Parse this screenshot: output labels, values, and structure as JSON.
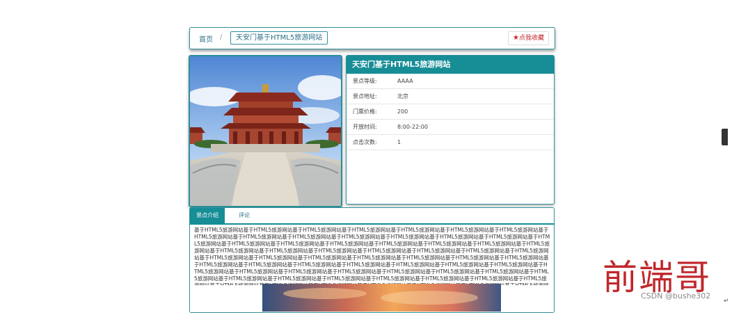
{
  "breadcrumb": {
    "home": "首页",
    "separator": "/",
    "current": "天安门基于HTML5旅游网站"
  },
  "favorite": {
    "icon": "star-icon",
    "label": "点我收藏"
  },
  "info": {
    "title": "天安门基于HTML5旅游网站",
    "rows": [
      {
        "key": "景点等级:",
        "value": "AAAA"
      },
      {
        "key": "景点地址:",
        "value": "北京"
      },
      {
        "key": "门票价格:",
        "value": "200"
      },
      {
        "key": "开放时间:",
        "value": "8:00-22:00"
      },
      {
        "key": "点击次数:",
        "value": "1"
      }
    ]
  },
  "tabs": [
    {
      "label": "景点介绍",
      "active": true
    },
    {
      "label": "评论",
      "active": false
    }
  ],
  "description": "基于HTML5旅游网站基于HTML5旅游网站基于HTML5旅游网站基于HTML5旅游网站基于HTML5旅游网站基于HTML5旅游网站基于HTML5旅游网站基于HTML5旅游网站基于HTML5旅游网站基于HTML5旅游网站基于HTML5旅游网站基于HTML5旅游网站基于HTML5旅游网站基于HTML5旅游网站基于HTML5旅游网站基于HTML5旅游网站基于HTML5旅游网站基于HTML5旅游网站基于HTML5旅游网站基于HTML5旅游网站基于HTML5旅游网站基于HTML5旅游网站基于HTML5旅游网站基于HTML5旅游网站基于HTML5旅游网站基于HTML5旅游网站基于HTML5旅游网站基于HTML5旅游网站基于HTML5旅游网站基于HTML5旅游网站基于HTML5旅游网站基于HTML5旅游网站基于HTML5旅游网站基于HTML5旅游网站基于HTML5旅游网站基于HTML5旅游网站基于HTML5旅游网站基于HTML5旅游网站基于HTML5旅游网站基于HTML5旅游网站基于HTML5旅游网站基于HTML5旅游网站基于HTML5旅游网站基于HTML5旅游网站基于HTML5旅游网站基于HTML5旅游网站基于HTML5旅游网站基于HTML5旅游网站基于HTML5旅游网站基于HTML5旅游网站基于HTML5旅游网站基于HTML5旅游网站基于HTML5旅游网站基于HTML5旅游网站基于HTML5旅游网站基于HTML5旅游网站基于HTML5旅游网站基于HTML5旅游网站基于HTML5旅游网站基于HTML5旅游网站基于HTML5旅游网站基于HTML5旅游网站基于HTML5旅游网站基于HTML5旅游网站基于HTML5旅游网站基于HTML5旅游网站基于HTML5旅游网站基于HTML5旅游网站基于HTML5旅游网站基于HTML5旅游网站基于HTML5旅游网站基于HTML5旅游网站基于HTML5旅游网站基于HTML5旅游网站基于HTML5旅游网站",
  "watermark": "前端哥",
  "csdn_credit": "CSDN @bushe302",
  "colors": {
    "accent": "#178d96",
    "favorite": "#d61f26",
    "watermark": "#c0282c"
  }
}
